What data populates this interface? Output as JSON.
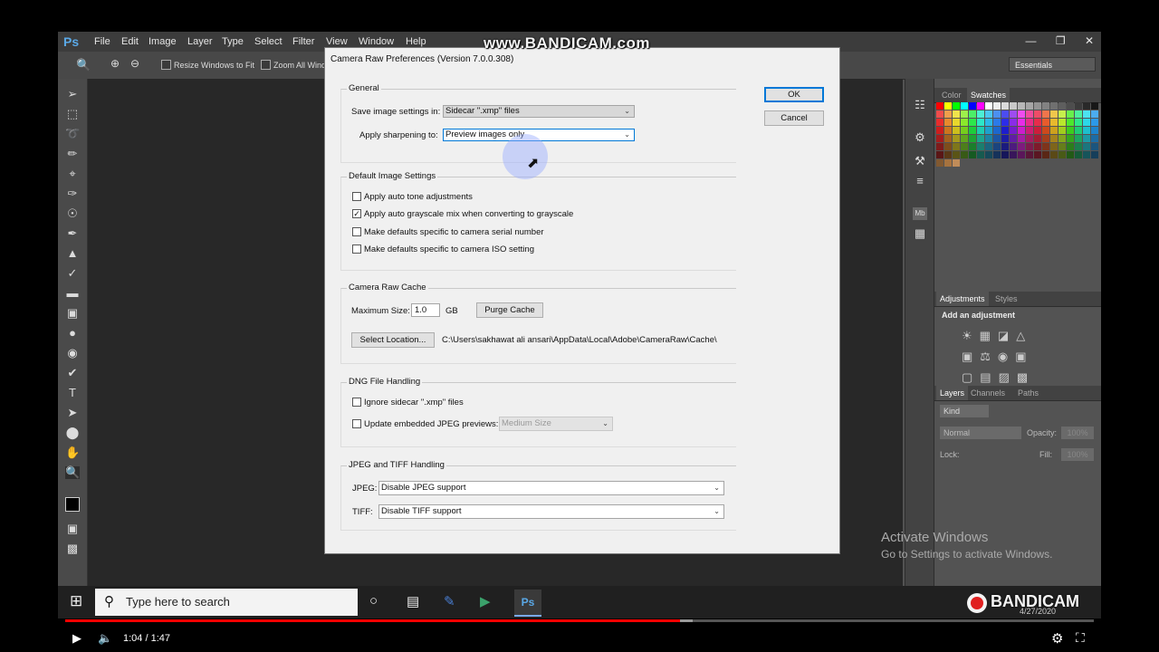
{
  "photoshop": {
    "logo": "Ps",
    "menu": [
      "File",
      "Edit",
      "Image",
      "Layer",
      "Type",
      "Select",
      "Filter",
      "View",
      "Window",
      "Help"
    ],
    "options": {
      "resize_windows": "Resize Windows to Fit",
      "zoom_all": "Zoom All Wind"
    },
    "workspace": "Essentials",
    "panels": {
      "color_tab": "Color",
      "swatches_tab": "Swatches",
      "adjustments_tab": "Adjustments",
      "styles_tab": "Styles",
      "add_adjustment": "Add an adjustment",
      "layers_tab": "Layers",
      "channels_tab": "Channels",
      "paths_tab": "Paths",
      "kind": "Kind",
      "blend_mode": "Normal",
      "opacity_label": "Opacity:",
      "opacity_value": "100%",
      "lock_label": "Lock:",
      "fill_label": "Fill:",
      "fill_value": "100%"
    }
  },
  "dialog": {
    "title": "Camera Raw Preferences  (Version 7.0.0.308)",
    "ok": "OK",
    "cancel": "Cancel",
    "general": {
      "legend": "General",
      "save_label": "Save image settings in:",
      "save_value": "Sidecar \".xmp\" files",
      "sharpen_label": "Apply sharpening to:",
      "sharpen_value": "Preview images only"
    },
    "defaults": {
      "legend": "Default Image Settings",
      "items": [
        {
          "label": "Apply auto tone adjustments",
          "checked": false
        },
        {
          "label": "Apply auto grayscale mix when converting to grayscale",
          "checked": true
        },
        {
          "label": "Make defaults specific to camera serial number",
          "checked": false
        },
        {
          "label": "Make defaults specific to camera ISO setting",
          "checked": false
        }
      ]
    },
    "cache": {
      "legend": "Camera Raw Cache",
      "max_label": "Maximum Size:",
      "max_value": "1.0",
      "unit": "GB",
      "purge": "Purge Cache",
      "select_location": "Select Location...",
      "path": "C:\\Users\\sakhawat ali ansari\\AppData\\Local\\Adobe\\CameraRaw\\Cache\\"
    },
    "dng": {
      "legend": "DNG File Handling",
      "ignore": "Ignore sidecar \".xmp\" files",
      "update": "Update embedded JPEG previews:",
      "update_value": "Medium Size"
    },
    "jpeg_tiff": {
      "legend": "JPEG and TIFF Handling",
      "jpeg_label": "JPEG:",
      "jpeg_value": "Disable JPEG support",
      "tiff_label": "TIFF:",
      "tiff_value": "Disable TIFF support"
    }
  },
  "activate": {
    "line1": "Activate Windows",
    "line2": "Go to Settings to activate Windows."
  },
  "taskbar": {
    "search_placeholder": "Type here to search"
  },
  "watermark": {
    "top": "www.BANDICAM.com",
    "bottom": "BANDICAM",
    "date": "4/27/2020"
  },
  "player": {
    "time": "1:04 / 1:47",
    "progress": 0.598,
    "buffered": 0.61
  },
  "colors": {
    "accent": "#0078d7",
    "progress": "#ff0000",
    "ps_logo": "#5aa8e6"
  }
}
